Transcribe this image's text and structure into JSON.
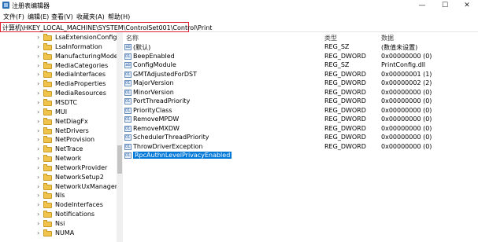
{
  "window": {
    "title": "注册表编辑器",
    "minimize": "—",
    "maximize": "☐",
    "close": "✕"
  },
  "menu": [
    "文件(F)",
    "编辑(E)",
    "查看(V)",
    "收藏夹(A)",
    "帮助(H)"
  ],
  "address": "计算机\\HKEY_LOCAL_MACHINE\\SYSTEM\\ControlSet001\\Control\\Print",
  "tree": [
    "LsaExtensionConfig",
    "LsaInformation",
    "ManufacturingMode",
    "MediaCategories",
    "MediaInterfaces",
    "MediaProperties",
    "MediaResources",
    "MSDTC",
    "MUI",
    "NetDiagFx",
    "NetDrivers",
    "NetProvision",
    "NetTrace",
    "Network",
    "NetworkProvider",
    "NetworkSetup2",
    "NetworkUxManager",
    "Nls",
    "NodeInterfaces",
    "Notifications",
    "Nsi",
    "NUMA"
  ],
  "columns": {
    "name": "名称",
    "type": "类型",
    "data": "数据"
  },
  "values": [
    {
      "name": "(默认)",
      "type": "REG_SZ",
      "data": "(数值未设置)",
      "icon": "ab"
    },
    {
      "name": "BeepEnabled",
      "type": "REG_DWORD",
      "data": "0x00000000 (0)",
      "icon": "011"
    },
    {
      "name": "ConfigModule",
      "type": "REG_SZ",
      "data": "PrintConfig.dll",
      "icon": "ab"
    },
    {
      "name": "GMTAdjustedForDST",
      "type": "REG_DWORD",
      "data": "0x00000001 (1)",
      "icon": "011"
    },
    {
      "name": "MajorVersion",
      "type": "REG_DWORD",
      "data": "0x00000002 (2)",
      "icon": "011"
    },
    {
      "name": "MinorVersion",
      "type": "REG_DWORD",
      "data": "0x00000000 (0)",
      "icon": "011"
    },
    {
      "name": "PortThreadPriority",
      "type": "REG_DWORD",
      "data": "0x00000000 (0)",
      "icon": "011"
    },
    {
      "name": "PriorityClass",
      "type": "REG_DWORD",
      "data": "0x00000000 (0)",
      "icon": "011"
    },
    {
      "name": "RemoveMPDW",
      "type": "REG_DWORD",
      "data": "0x00000000 (0)",
      "icon": "011"
    },
    {
      "name": "RemoveMXDW",
      "type": "REG_DWORD",
      "data": "0x00000000 (0)",
      "icon": "011"
    },
    {
      "name": "SchedulerThreadPriority",
      "type": "REG_DWORD",
      "data": "0x00000000 (0)",
      "icon": "011"
    },
    {
      "name": "ThrowDriverException",
      "type": "REG_DWORD",
      "data": "0x00000000 (0)",
      "icon": "011"
    },
    {
      "name": "RpcAuthnLevelPrivacyEnabled",
      "type": "",
      "data": "",
      "icon": "011",
      "selected": true
    }
  ]
}
